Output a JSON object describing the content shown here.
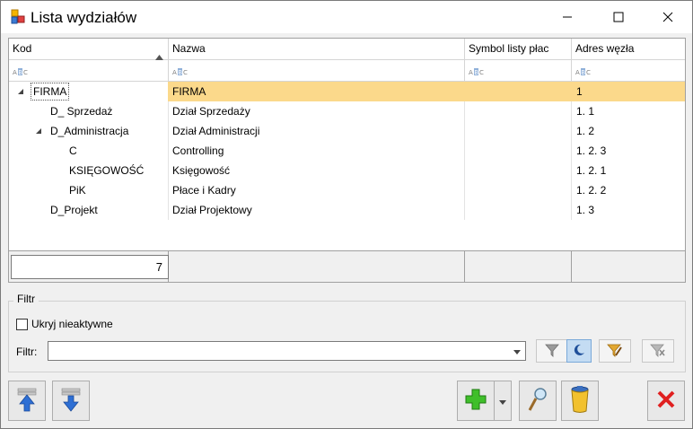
{
  "window": {
    "title": "Lista wydziałów"
  },
  "grid": {
    "columns": [
      "Kod",
      "Nazwa",
      "Symbol listy płac",
      "Adres węzła"
    ],
    "rows": [
      {
        "kod": "FIRMA",
        "nazwa": "FIRMA",
        "symbol": "",
        "adres": "1"
      },
      {
        "kod": "D_ Sprzedaż",
        "nazwa": "Dział Sprzedaży",
        "symbol": "",
        "adres": "1. 1"
      },
      {
        "kod": "D_Administracja",
        "nazwa": "Dział Administracji",
        "symbol": "",
        "adres": "1. 2"
      },
      {
        "kod": "C",
        "nazwa": "Controlling",
        "symbol": "",
        "adres": "1. 2. 3"
      },
      {
        "kod": "KSIĘGOWOŚĆ",
        "nazwa": "Księgowość",
        "symbol": "",
        "adres": "1. 2. 1"
      },
      {
        "kod": "PiK",
        "nazwa": "Płace i Kadry",
        "symbol": "",
        "adres": "1. 2. 2"
      },
      {
        "kod": "D_Projekt",
        "nazwa": "Dział Projektowy",
        "symbol": "",
        "adres": "1. 3"
      }
    ],
    "count": "7"
  },
  "filter": {
    "group_label": "Filtr",
    "hide_inactive_label": "Ukryj nieaktywne",
    "filter_label": "Filtr:",
    "filter_value": ""
  },
  "colors": {
    "selected_row": "#fbd98b",
    "window_bg": "#f0f0f0"
  }
}
